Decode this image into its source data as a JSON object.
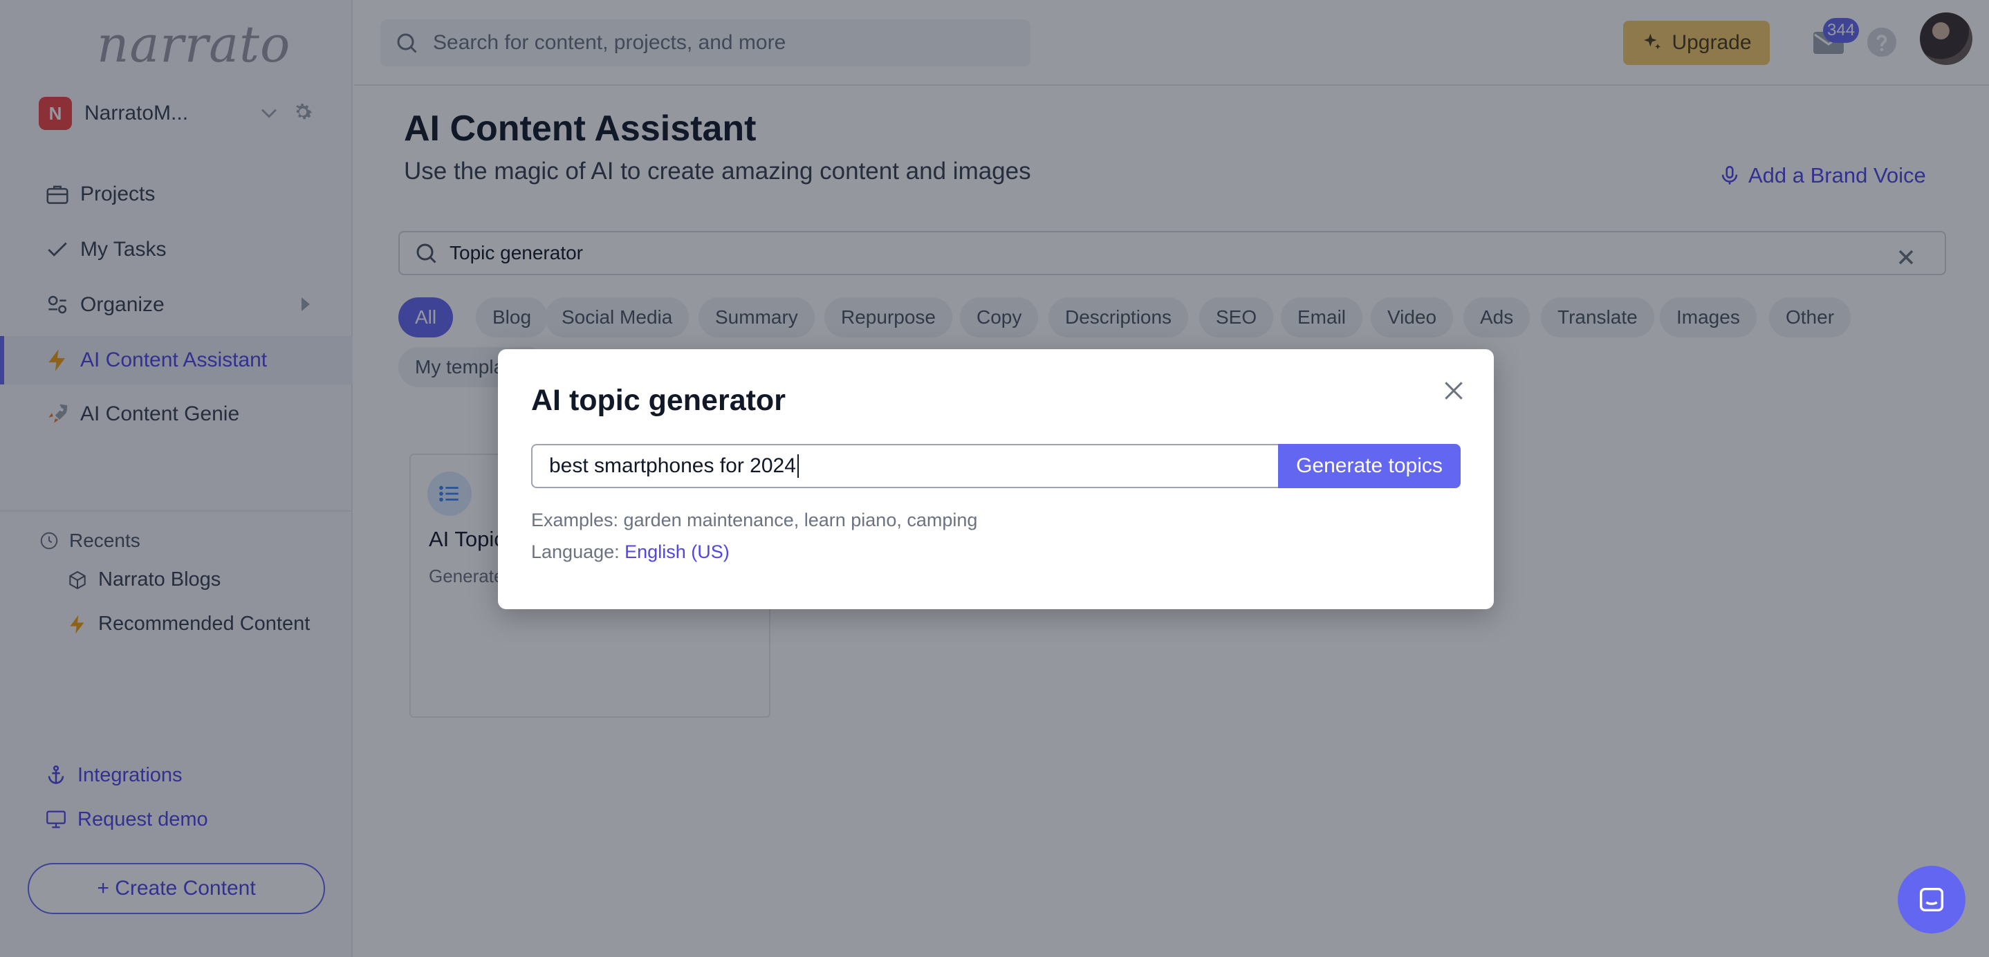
{
  "sidebar": {
    "logo": "narrato",
    "workspace": {
      "initial": "N",
      "name": "NarratoM..."
    },
    "nav": [
      {
        "label": "Projects"
      },
      {
        "label": "My Tasks"
      },
      {
        "label": "Organize"
      },
      {
        "label": "AI Content Assistant"
      },
      {
        "label": "AI Content Genie"
      }
    ],
    "recents": {
      "heading": "Recents",
      "items": [
        {
          "label": "Narrato Blogs"
        },
        {
          "label": "Recommended Content"
        }
      ]
    },
    "footer": {
      "integrations": "Integrations",
      "request_demo": "Request demo",
      "create_content": "+ Create Content"
    }
  },
  "header": {
    "search_placeholder": "Search for content, projects, and more",
    "upgrade": "Upgrade",
    "notifications_count": "344"
  },
  "main": {
    "title": "AI Content Assistant",
    "subtitle": "Use the magic of AI to create amazing content and images",
    "brand_voice": "Add a Brand Voice",
    "template_search": "Topic generator",
    "chips": [
      "All",
      "Blog",
      "Social Media",
      "Summary",
      "Repurpose",
      "Copy",
      "Descriptions",
      "SEO",
      "Email",
      "Video",
      "Ads",
      "Translate",
      "Images",
      "Other"
    ],
    "chips_row2": [
      "My templates"
    ],
    "card": {
      "title": "AI Topic generator",
      "desc": "Generate topic ideas"
    }
  },
  "modal": {
    "title": "AI topic generator",
    "input_value": "best smartphones for 2024",
    "button": "Generate topics",
    "examples": "Examples: garden maintenance, learn piano, camping",
    "language_label": "Language:",
    "language_value": "English (US)"
  },
  "colors": {
    "accent": "#6366f1",
    "upgrade": "#f3c968",
    "badge_red": "#ef4444"
  }
}
